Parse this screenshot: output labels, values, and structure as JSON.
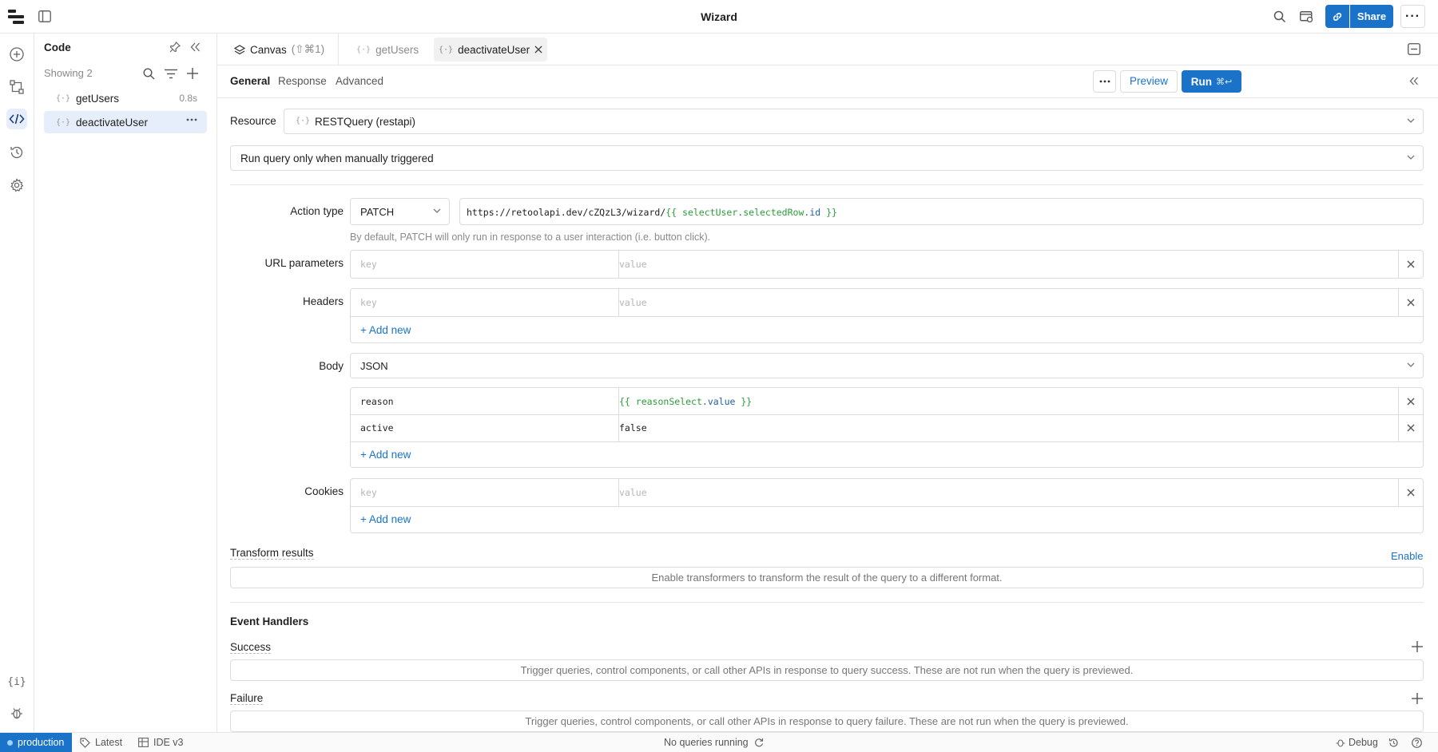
{
  "app": {
    "title": "Wizard"
  },
  "topbar": {
    "share_label": "Share"
  },
  "sidebar": {
    "title": "Code",
    "showing": "Showing 2",
    "items": [
      {
        "label": "getUsers",
        "meta": "0.8s"
      },
      {
        "label": "deactivateUser",
        "meta": ""
      }
    ]
  },
  "tabs": {
    "canvas_label": "Canvas",
    "canvas_shortcut": "(⇧⌘1)",
    "items": [
      {
        "label": "getUsers"
      },
      {
        "label": "deactivateUser"
      }
    ]
  },
  "subtabs": [
    {
      "label": "General"
    },
    {
      "label": "Response"
    },
    {
      "label": "Advanced"
    }
  ],
  "toolbar": {
    "preview_label": "Preview",
    "run_label": "Run",
    "run_shortcut": "⌘↩"
  },
  "resource": {
    "label": "Resource",
    "value": "RESTQuery (restapi)"
  },
  "trigger": {
    "value": "Run query only when manually triggered"
  },
  "action": {
    "label": "Action type",
    "method": "PATCH",
    "url_prefix": "https://retoolapi.dev/cZQzL3/wizard/",
    "url_open": "{{ ",
    "url_obj": "selectUser",
    "url_dot1": ".",
    "url_prop1": "selectedRow",
    "url_dot2": ".",
    "url_prop2": "id",
    "url_close": " }}",
    "hint": "By default, PATCH will only run in response to a user interaction (i.e. button click)."
  },
  "url_params": {
    "label": "URL parameters",
    "key_placeholder": "key",
    "value_placeholder": "value"
  },
  "headers": {
    "label": "Headers",
    "key_placeholder": "key",
    "value_placeholder": "value",
    "add_label": "+ Add new"
  },
  "body": {
    "label": "Body",
    "type": "JSON",
    "rows": [
      {
        "key": "reason",
        "v_open": "{{ ",
        "v_obj": "reasonSelect",
        "v_dot": ".",
        "v_prop": "value",
        "v_close": " }}"
      },
      {
        "key": "active",
        "value": "false"
      }
    ],
    "add_label": "+ Add new"
  },
  "cookies": {
    "label": "Cookies",
    "key_placeholder": "key",
    "value_placeholder": "value",
    "add_label": "+ Add new"
  },
  "transform": {
    "label": "Transform results",
    "enable_label": "Enable",
    "hint": "Enable transformers to transform the result of the query to a different format."
  },
  "events": {
    "title": "Event Handlers",
    "success_label": "Success",
    "success_hint": "Trigger queries, control components, or call other APIs in response to query success. These are not run when the query is previewed.",
    "failure_label": "Failure",
    "failure_hint": "Trigger queries, control components, or call other APIs in response to query failure. These are not run when the query is previewed."
  },
  "status": {
    "env": "production",
    "version": "Latest",
    "ide": "IDE v3",
    "queries": "No queries running",
    "debug": "Debug"
  },
  "colors": {
    "accent": "#1a73c8",
    "selected_bg": "#e7eefb",
    "template_green": "#2c9b3a"
  },
  "icons": [
    "retool-logo-icon",
    "sidebar-toggle-icon",
    "search-icon",
    "preview-app-icon",
    "link-icon",
    "more-icon",
    "add-icon",
    "tree-icon",
    "code-icon",
    "history-icon",
    "gear-icon",
    "braces-icon",
    "bug-icon",
    "pin-icon",
    "collapse-icon",
    "filter-icon",
    "layers-icon",
    "close-icon",
    "chevron-down-icon",
    "undo-icon",
    "help-icon",
    "refresh-icon",
    "table-icon",
    "tag-icon",
    "panel-icon"
  ]
}
